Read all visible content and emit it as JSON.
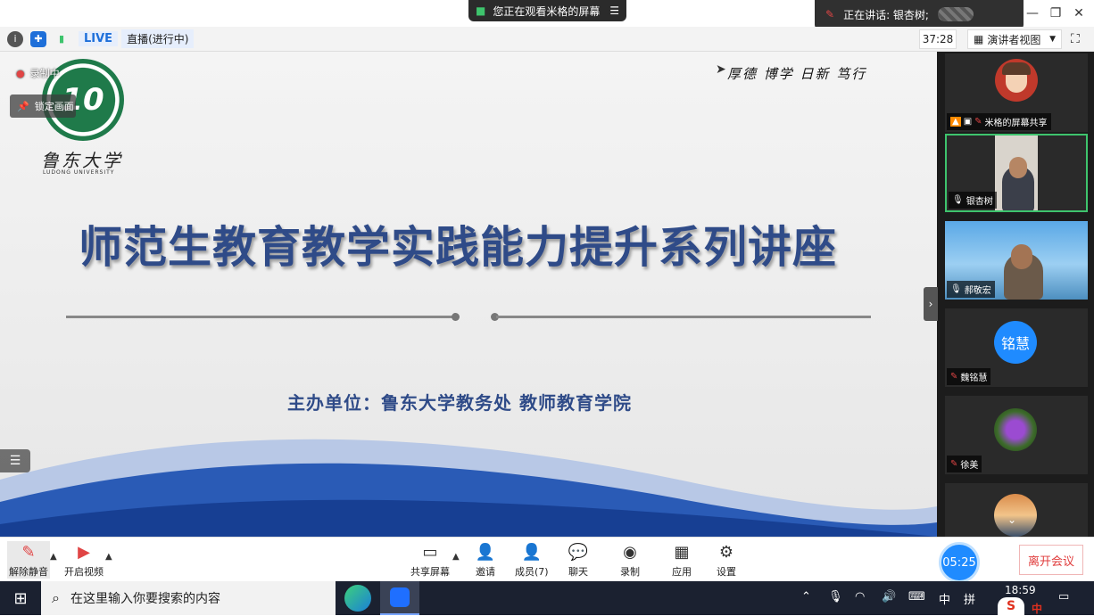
{
  "viewing_banner": "您正在观看米格的屏幕",
  "speaker_banner": {
    "prefix": "正在讲话: 银杏树;"
  },
  "infobar": {
    "live_tag": "LIVE",
    "live_status": "直播(进行中)",
    "elapsed": "37:28",
    "view_mode": "演讲者视图"
  },
  "slide": {
    "recording_label": "录制中",
    "pin_label": "锁定画面",
    "logo_text": "10",
    "university_name": "鲁东大学",
    "university_en": "LUDONG UNIVERSITY",
    "motto": "厚德 博学 日新 笃行",
    "title": "师范生教育教学实践能力提升系列讲座",
    "organizer": "主办单位：鲁东大学教务处 教师教育学院"
  },
  "gallery": [
    {
      "name": "米格的屏幕共享",
      "muted": true
    },
    {
      "name": "银杏树",
      "muted": false
    },
    {
      "name": "郝敬宏",
      "muted": false
    },
    {
      "name": "魏铭慧",
      "muted": true,
      "avatar_text": "铭慧"
    },
    {
      "name": "徐美",
      "muted": true
    }
  ],
  "toolbar": {
    "unmute": "解除静音",
    "start_video": "开启视频",
    "share_screen": "共享屏幕",
    "invite": "邀请",
    "members": "成员(7)",
    "chat": "聊天",
    "record": "录制",
    "apps": "应用",
    "settings": "设置",
    "countdown": "05:25",
    "leave": "离开会议"
  },
  "taskbar": {
    "search_placeholder": "在这里输入你要搜索的内容",
    "ime_lang": "中",
    "ime_mode": "拼",
    "time": "18:59",
    "ime_tray": "中"
  },
  "colors": {
    "title_blue": "#2f4b88",
    "live_blue": "#1e6fd9",
    "accent_green": "#3ec46d",
    "leave_red": "#e03c3c",
    "clock_blue": "#1f8bff"
  }
}
